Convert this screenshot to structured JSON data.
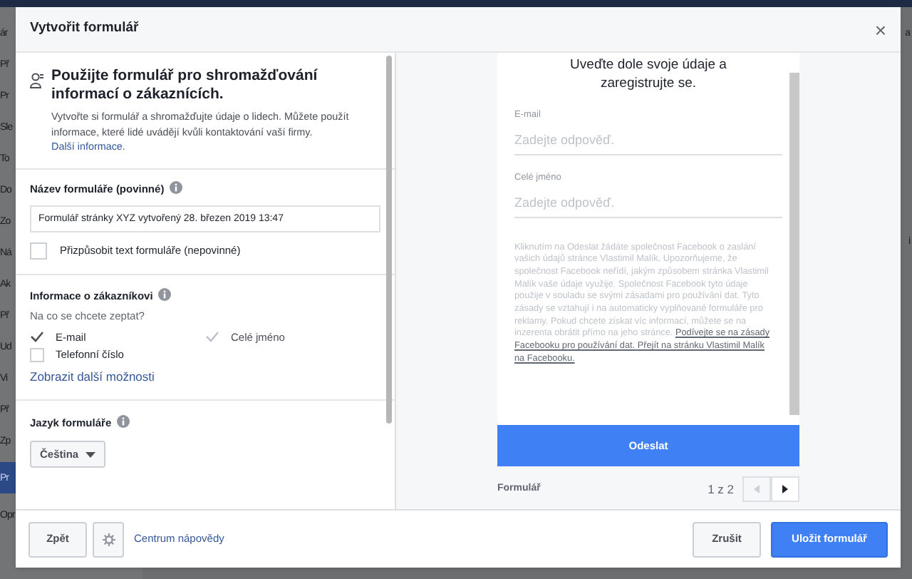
{
  "background": {
    "left_items": [
      {
        "text": "ár",
        "selected": false
      },
      {
        "text": "Př",
        "selected": false
      },
      {
        "text": "Pr",
        "selected": false
      },
      {
        "text": "Sle",
        "selected": false
      },
      {
        "text": "To",
        "selected": false
      },
      {
        "text": "Do",
        "selected": false
      },
      {
        "text": "Zo",
        "selected": false
      },
      {
        "text": "Ná",
        "selected": false
      },
      {
        "text": "Ak",
        "selected": false
      },
      {
        "text": "Př",
        "selected": false
      },
      {
        "text": "Ud",
        "selected": false
      },
      {
        "text": "Vi",
        "selected": false
      },
      {
        "text": "Př",
        "selected": false
      },
      {
        "text": "Zp",
        "selected": false
      },
      {
        "text": "Pr",
        "selected": true
      },
      {
        "text": "Opr",
        "selected": false
      }
    ],
    "right_items": [
      "a",
      "i"
    ]
  },
  "dialog": {
    "title": "Vytvořit formulář",
    "close": "×"
  },
  "intro": {
    "heading": "Použijte formulář pro shromažďování informací o zákaznících.",
    "text": "Vytvořte si formulář a shromažďujte údaje o lidech. Můžete použít informace, které lidé uvádějí kvůli kontaktování vaší firmy.",
    "link": "Další informace."
  },
  "form_name": {
    "label": "Název formuláře (povinné)",
    "value": "Formulář stránky XYZ vytvořený 28. březen 2019 13:47"
  },
  "customize": {
    "label": "Přizpůsobit text formuláře (nepovinné)",
    "checked": false
  },
  "customer_info": {
    "label": "Informace o zákazníkovi",
    "question": "Na co se chcete zeptat?",
    "options": [
      {
        "label": "E-mail",
        "checked": true,
        "disabled": false
      },
      {
        "label": "Celé jméno",
        "checked": true,
        "disabled": true
      },
      {
        "label": "Telefonní číslo",
        "checked": false,
        "disabled": false
      }
    ],
    "more_link": "Zobrazit další možnosti"
  },
  "language": {
    "label": "Jazyk formuláře",
    "value": "Čeština"
  },
  "preview": {
    "heading": "Uveďte dole svoje údaje a zaregistrujte se.",
    "fields": [
      {
        "label": "E-mail",
        "placeholder": "Zadejte odpověď."
      },
      {
        "label": "Celé jméno",
        "placeholder": "Zadejte odpověď."
      }
    ],
    "disclaimer": "Kliknutím na Odeslat žádáte společnost Facebook o zaslání vašich údajů stránce Vlastimil Malík. Upozorňujeme, že společnost Facebook neřídí, jakým způsobem stránka Vlastimil Malík vaše údaje využije. Společnost Facebook tyto údaje použije v souladu se svými zásadami pro používání dat. Tyto zásady se vztahují i na automaticky vyplňované formuláře pro reklamy. Pokud chcete získat víc informací, můžete se na inzerenta obrátit přímo na jeho stránce.",
    "links": [
      "Podívejte se na zásady Facebooku pro používání dat.",
      "Přejít na stránku Vlastimil Malík na Facebooku."
    ],
    "submit": "Odeslat",
    "caption": "Formulář",
    "pager": "1 z 2",
    "prev_disabled": true,
    "next_disabled": false
  },
  "footer": {
    "back": "Zpět",
    "help": "Centrum nápovědy",
    "cancel": "Zrušit",
    "save": "Uložit formulář"
  }
}
